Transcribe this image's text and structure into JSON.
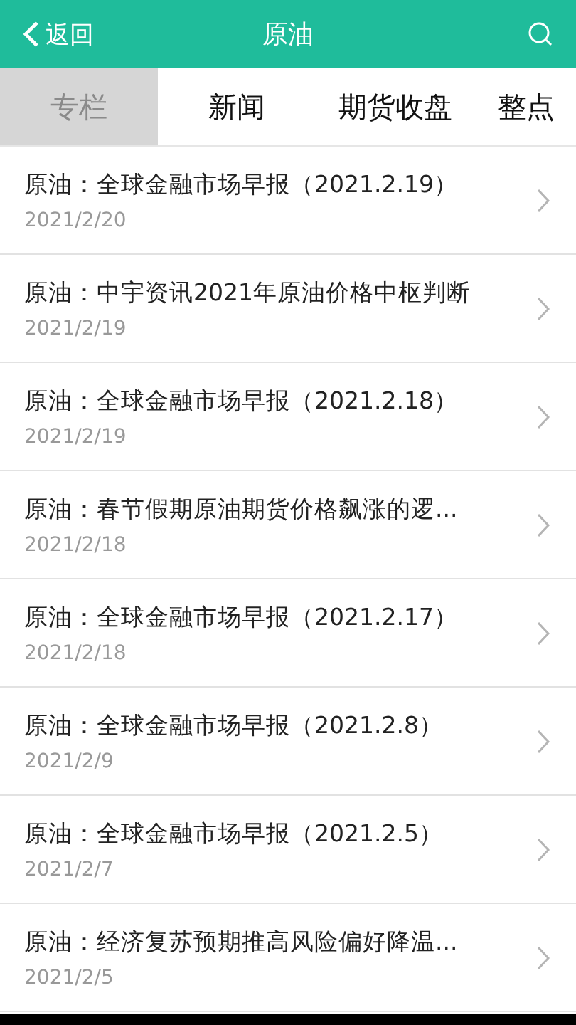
{
  "header": {
    "back": "返回",
    "title": "原油"
  },
  "tabs": [
    {
      "label": "专栏",
      "selected": true
    },
    {
      "label": "新闻",
      "selected": false
    },
    {
      "label": "期货收盘",
      "selected": false
    },
    {
      "label": "整点",
      "selected": false
    }
  ],
  "articles": [
    {
      "title": "原油：全球金融市场早报（2021.2.19）",
      "date": "2021/2/20"
    },
    {
      "title": "原油：中宇资讯2021年原油价格中枢判断",
      "date": "2021/2/19"
    },
    {
      "title": "原油：全球金融市场早报（2021.2.18）",
      "date": "2021/2/19"
    },
    {
      "title": "原油：春节假期原油期货价格飙涨的逻...",
      "date": "2021/2/18"
    },
    {
      "title": "原油：全球金融市场早报（2021.2.17）",
      "date": "2021/2/18"
    },
    {
      "title": "原油：全球金融市场早报（2021.2.8）",
      "date": "2021/2/9"
    },
    {
      "title": "原油：全球金融市场早报（2021.2.5）",
      "date": "2021/2/7"
    },
    {
      "title": "原油：经济复苏预期推高风险偏好降温...",
      "date": "2021/2/5"
    }
  ]
}
